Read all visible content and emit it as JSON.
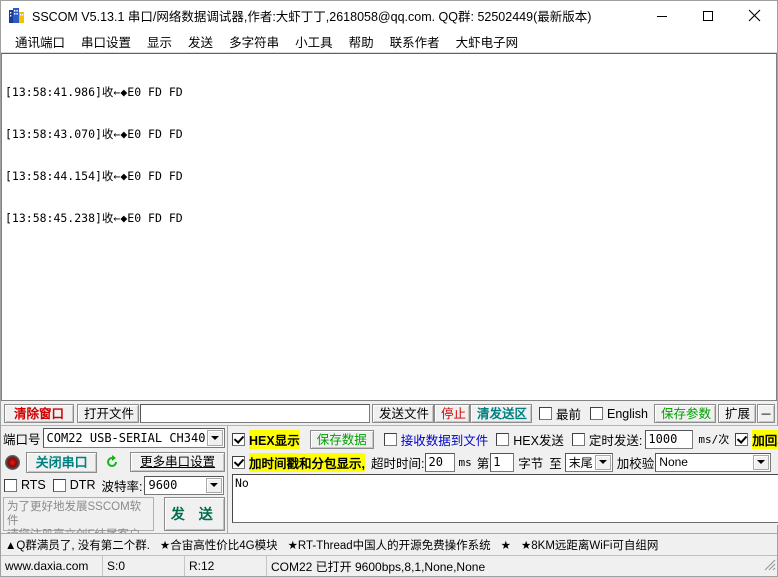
{
  "window": {
    "title": "SSCOM V5.13.1 串口/网络数据调试器,作者:大虾丁丁,2618058@qq.com. QQ群: 52502449(最新版本)",
    "icon": "app-logo-icon",
    "minimize": "─",
    "maximize": "☐",
    "close": "✕"
  },
  "menu": {
    "items": [
      {
        "label": "通讯端口"
      },
      {
        "label": "串口设置"
      },
      {
        "label": "显示"
      },
      {
        "label": "发送"
      },
      {
        "label": "多字符串"
      },
      {
        "label": "小工具"
      },
      {
        "label": "帮助"
      },
      {
        "label": "联系作者"
      },
      {
        "label": "大虾电子网"
      }
    ]
  },
  "log": {
    "lines": [
      "[13:58:41.986]收←◆E0 FD FD",
      "[13:58:43.070]收←◆E0 FD FD",
      "[13:58:44.154]收←◆E0 FD FD",
      "[13:58:45.238]收←◆E0 FD FD"
    ]
  },
  "toolbar": {
    "clear_window": "清除窗口",
    "open_file": "打开文件",
    "file_path": "",
    "file_path_placeholder": "",
    "send_file": "发送文件",
    "stop": "停止",
    "clear_send": "清发送区",
    "topmost": "最前",
    "topmost_checked": false,
    "english": "English",
    "english_checked": false,
    "save_params": "保存参数",
    "extend": "扩展",
    "collapse": "─"
  },
  "port_panel": {
    "port_label": "端口号",
    "port_value": "COM22 USB-SERIAL CH340",
    "close_port": "关闭串口",
    "refresh_icon": "refresh-icon",
    "more_settings": "更多串口设置",
    "rts_label": "RTS",
    "rts_checked": false,
    "dtr_label": "DTR",
    "dtr_checked": false,
    "baud_label": "波特率:",
    "baud_value": "9600",
    "promo_line1": "为了更好地发展SSCOM软件",
    "promo_line2": "请您注册嘉立创F结尾客户",
    "send_button": "发 送"
  },
  "display_panel": {
    "hex_display": "HEX显示",
    "hex_display_checked": true,
    "save_data": "保存数据",
    "recv_to_file": "接收数据到文件",
    "recv_to_file_checked": false,
    "hex_send": "HEX发送",
    "hex_send_checked": false,
    "timed_send": "定时发送:",
    "timed_send_checked": false,
    "timed_interval": "1000",
    "timed_unit": "ms/次",
    "append_crlf": "加回车换行",
    "append_crlf_checked": true,
    "help_marker": "?",
    "timestamp_pack": "加时间戳和分包显示,",
    "timestamp_pack_checked": true,
    "timeout_label": "超时时间:",
    "timeout_value": "20",
    "timeout_unit": "ms",
    "byte_from_label": "第",
    "byte_from_value": "1",
    "byte_label": "字节",
    "byte_to_label": "至",
    "byte_to_value": "末尾",
    "checksum_label": "加校验",
    "checksum_value": "None",
    "send_text": "No"
  },
  "ad_bar": {
    "items": [
      "▲Q群满员了, 没有第二个群.",
      "★合宙高性价比4G模块",
      "★RT-Thread中国人的开源免费操作系统",
      "★",
      "★8KM远距离WiFi可自组网"
    ]
  },
  "status_bar": {
    "website": "www.daxia.com",
    "sent": "S:0",
    "received": "R:12",
    "connection": "COM22 已打开  9600bps,8,1,None,None"
  },
  "colors": {
    "highlight": "#ffff00",
    "red": "#cc0000",
    "teal": "#008080",
    "green": "#00a000",
    "blue_link": "#0000cc"
  }
}
